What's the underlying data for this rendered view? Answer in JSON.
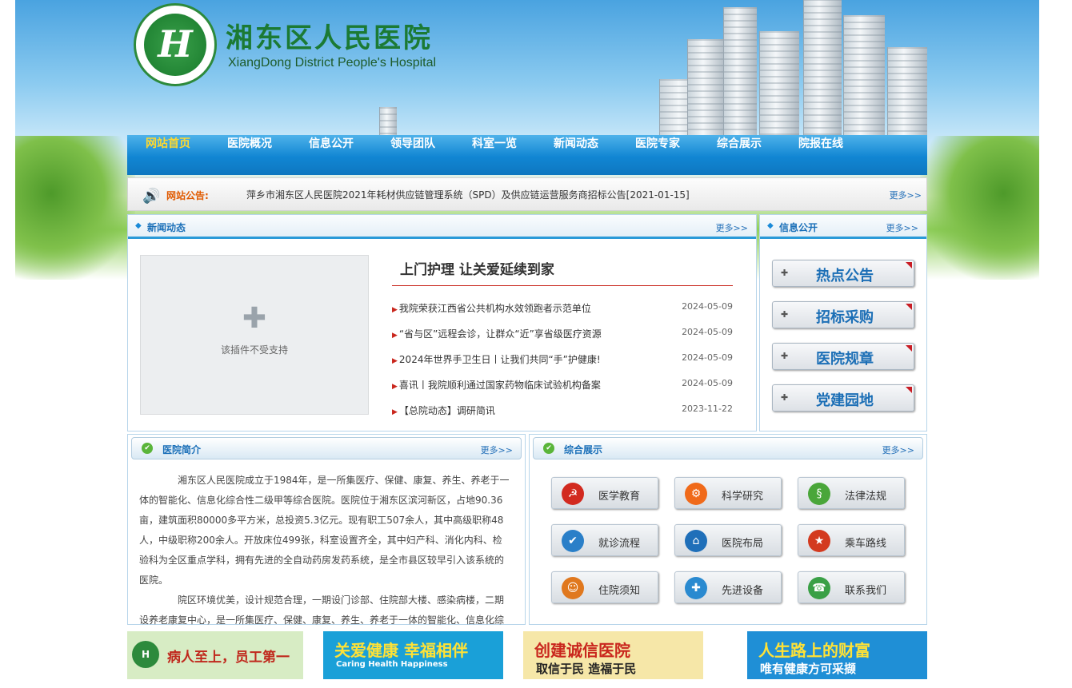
{
  "header": {
    "title": "湘东区人民医院",
    "title_en": "XiangDong District People's Hospital",
    "logo_letter": "H"
  },
  "nav": [
    {
      "label": "网站首页",
      "active": true
    },
    {
      "label": "医院概况"
    },
    {
      "label": "信息公开"
    },
    {
      "label": "领导团队"
    },
    {
      "label": "科室一览"
    },
    {
      "label": "新闻动态"
    },
    {
      "label": "医院专家"
    },
    {
      "label": "综合展示"
    },
    {
      "label": "院报在线"
    }
  ],
  "notice": {
    "label": "网站公告:",
    "text": "萍乡市湘东区人民医院2021年耗材供应链管理系统（SPD）及供应链运营服务商招标公告[2021-01-15]",
    "more": "更多>>"
  },
  "news": {
    "title": "新闻动态",
    "more": "更多>>",
    "flash_text": "该插件不受支持",
    "headline": "上门护理  让关爱延续到家",
    "items": [
      {
        "title": "我院荣获江西省公共机构水效领跑者示范单位",
        "date": "2024-05-09"
      },
      {
        "title": "“省与区”远程会诊，让群众“近”享省级医疗资源",
        "date": "2024-05-09"
      },
      {
        "title": "2024年世界手卫生日丨让我们共同“手”护健康!",
        "date": "2024-05-09"
      },
      {
        "title": "喜讯丨我院顺利通过国家药物临床试验机构备案",
        "date": "2024-05-09"
      },
      {
        "title": "【总院动态】调研简讯",
        "date": "2023-11-22"
      }
    ]
  },
  "info": {
    "title": "信息公开",
    "more": "更多>>",
    "buttons": [
      "热点公告",
      "招标采购",
      "医院规章",
      "党建园地"
    ]
  },
  "intro": {
    "title": "医院简介",
    "more": "更多>>",
    "p1": "湘东区人民医院成立于1984年，是一所集医疗、保健、康复、养生、养老于一体的智能化、信息化综合性二级甲等综合医院。医院位于湘东区滨河新区，占地90.36亩，建筑面积80000多平方米，总投资5.3亿元。现有职工507余人，其中高级职称48人，中级职称200余人。开放床位499张，科室设置齐全，其中妇产科、消化内科、检验科为全区重点学科，拥有先进的全自动药房发药系统，是全市县区较早引入该系统的医院。",
    "p2": "院区环境优美，设计规范合理，一期设门诊部、住院部大楼、感染病楼，二期设养老康复中心，是一所集医疗、保健、康复、养生、养老于一体的智能化、信息化综"
  },
  "showcase": {
    "title": "综合展示",
    "more": "更多>>",
    "items": [
      {
        "label": "医学教育",
        "icon": "party-emblem-icon",
        "glyph": "☭",
        "color": "#d22a1f"
      },
      {
        "label": "科学研究",
        "icon": "research-gear-icon",
        "glyph": "⚙",
        "color": "#f06a1a"
      },
      {
        "label": "法律法规",
        "icon": "law-icon",
        "glyph": "§",
        "color": "#4aa63a"
      },
      {
        "label": "就诊流程",
        "icon": "shield-icon",
        "glyph": "✔",
        "color": "#2a7fc8"
      },
      {
        "label": "医院布局",
        "icon": "home-icon",
        "glyph": "⌂",
        "color": "#1f6fb9"
      },
      {
        "label": "乘车路线",
        "icon": "police-badge-icon",
        "glyph": "★",
        "color": "#d33a1f"
      },
      {
        "label": "住院须知",
        "icon": "people-icon",
        "glyph": "☺",
        "color": "#e0781e"
      },
      {
        "label": "先进设备",
        "icon": "equipment-icon",
        "glyph": "✚",
        "color": "#2a8ad0"
      },
      {
        "label": "联系我们",
        "icon": "building-icon",
        "glyph": "☎",
        "color": "#3aa046"
      }
    ]
  },
  "banners": [
    {
      "text": "病人至上，员工第一",
      "bg": "#d7ecc4",
      "fg": "#c0281d"
    },
    {
      "text": "关爱健康 幸福相伴",
      "sub": "Caring Health Happiness",
      "bg": "#1aa0d8",
      "fg": "#ffe236"
    },
    {
      "text": "创建诚信医院",
      "sub": "取信于民 造福于民",
      "bg": "#f6e7a8",
      "fg": "#c9261d"
    },
    {
      "text": "人生路上的财富",
      "sub": "唯有健康方可采撷",
      "bg": "#1f8fd6",
      "fg": "#ffe236"
    }
  ]
}
